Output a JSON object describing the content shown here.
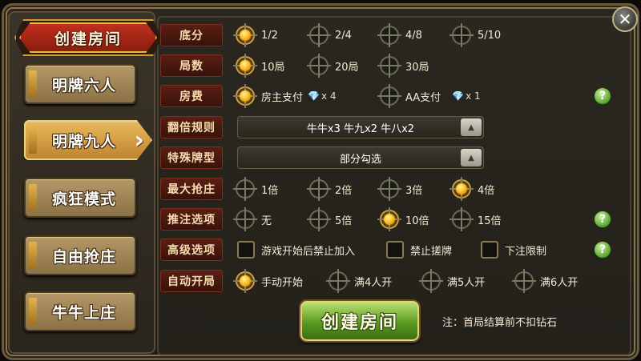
{
  "title": "创建房间",
  "sidebar": {
    "items": [
      {
        "label": "明牌六人",
        "active": false
      },
      {
        "label": "明牌九人",
        "active": true
      },
      {
        "label": "疯狂模式",
        "active": false
      },
      {
        "label": "自由抢庄",
        "active": false
      },
      {
        "label": "牛牛上庄",
        "active": false
      }
    ]
  },
  "rows": {
    "base_score": {
      "label": "底分",
      "options": [
        "1/2",
        "2/4",
        "4/8",
        "5/10"
      ],
      "selected": 0
    },
    "rounds": {
      "label": "局数",
      "options": [
        "10局",
        "20局",
        "30局"
      ],
      "selected": 0
    },
    "room_fee": {
      "label": "房费",
      "options": [
        "房主支付",
        "AA支付"
      ],
      "multipliers": [
        "x 4",
        "x 1"
      ],
      "selected": 0
    },
    "double_rule": {
      "label": "翻倍规则",
      "value": "牛牛x3  牛九x2  牛八x2"
    },
    "special_cards": {
      "label": "特殊牌型",
      "value": "部分勾选"
    },
    "max_banker": {
      "label": "最大抢庄",
      "options": [
        "1倍",
        "2倍",
        "3倍",
        "4倍"
      ],
      "selected": 3
    },
    "push_bet": {
      "label": "推注选项",
      "options": [
        "无",
        "5倍",
        "10倍",
        "15倍"
      ],
      "selected": 2
    },
    "advanced": {
      "label": "高级选项",
      "options": [
        "游戏开始后禁止加入",
        "禁止搓牌",
        "下注限制"
      ]
    },
    "auto_start": {
      "label": "自动开局",
      "options": [
        "手动开始",
        "满4人开",
        "满5人开",
        "满6人开"
      ],
      "selected": 0
    }
  },
  "create_button": "创建房间",
  "note": "注：首局结算前不扣钻石",
  "help": "?",
  "close": "✕",
  "colors": {
    "accent": "#ffc020",
    "label_bg": "#5a1f12",
    "create_green": "#5a9a20"
  }
}
